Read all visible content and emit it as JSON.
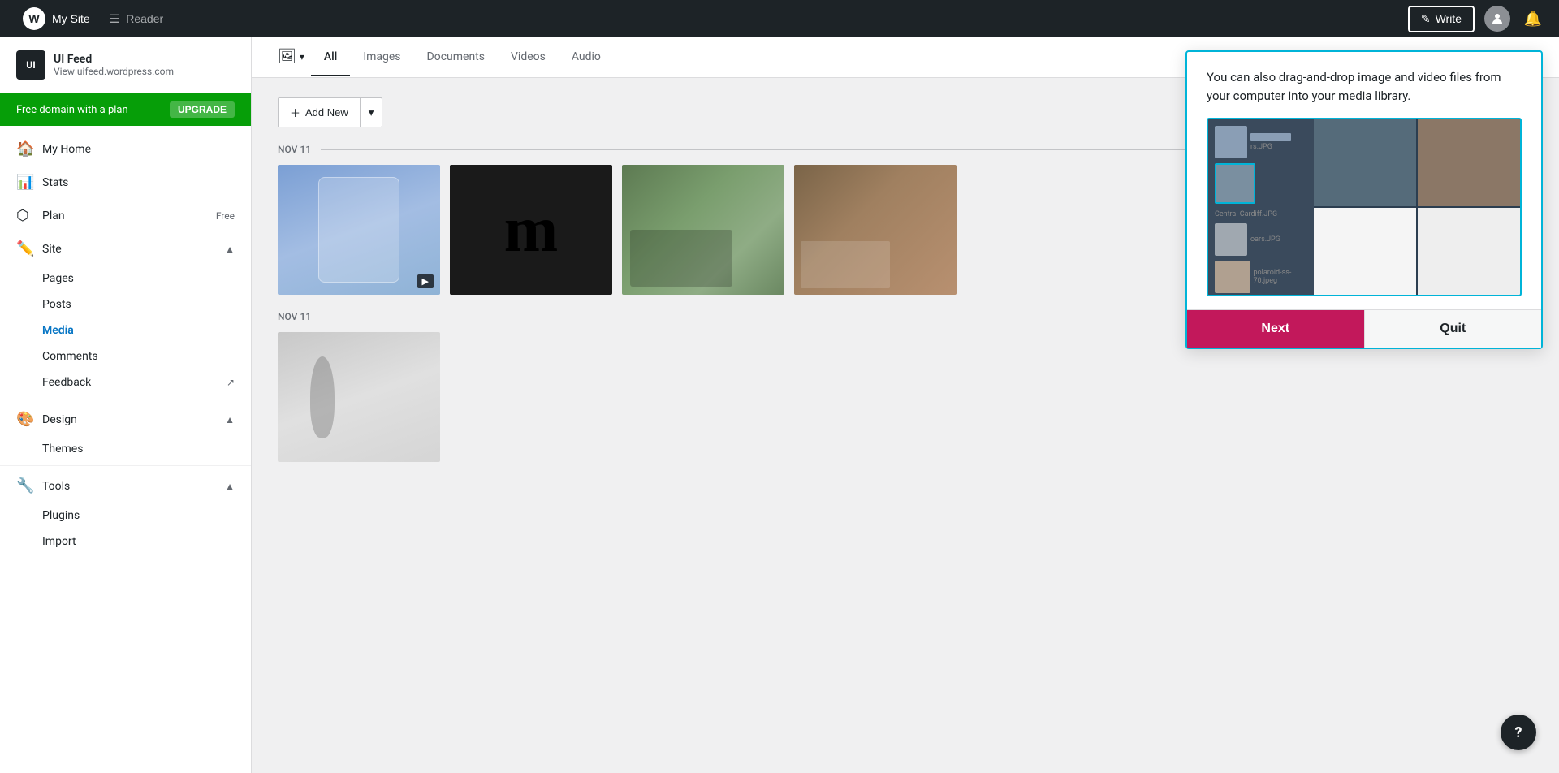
{
  "topbar": {
    "site_label": "My Site",
    "reader_label": "Reader",
    "write_label": "Write"
  },
  "sidebar": {
    "site_name": "UI Feed",
    "site_url": "View uifeed.wordpress.com",
    "site_icon_text": "UI",
    "upgrade_text": "Free domain with a plan",
    "upgrade_btn": "UPGRADE",
    "nav_items": [
      {
        "id": "my-home",
        "label": "My Home",
        "icon": "🏠",
        "badge": ""
      },
      {
        "id": "stats",
        "label": "Stats",
        "icon": "📊",
        "badge": ""
      },
      {
        "id": "plan",
        "label": "Plan",
        "icon": "⬡",
        "badge": "Free"
      },
      {
        "id": "site",
        "label": "Site",
        "icon": "✏️",
        "badge": "",
        "expanded": true
      }
    ],
    "site_subnav": [
      {
        "id": "pages",
        "label": "Pages"
      },
      {
        "id": "posts",
        "label": "Posts"
      },
      {
        "id": "media",
        "label": "Media",
        "active": true
      },
      {
        "id": "comments",
        "label": "Comments"
      },
      {
        "id": "feedback",
        "label": "Feedback",
        "external": true
      }
    ],
    "design_items": [
      {
        "id": "design",
        "label": "Design",
        "icon": "🎨",
        "expanded": true
      }
    ],
    "design_subnav": [
      {
        "id": "themes",
        "label": "Themes"
      }
    ],
    "tools_items": [
      {
        "id": "tools",
        "label": "Tools",
        "icon": "🔧",
        "expanded": true
      }
    ],
    "tools_subnav": [
      {
        "id": "plugins",
        "label": "Plugins"
      },
      {
        "id": "import",
        "label": "Import"
      }
    ]
  },
  "media": {
    "filter_icon": "🖼",
    "tabs": [
      {
        "id": "all",
        "label": "All",
        "active": true
      },
      {
        "id": "images",
        "label": "Images"
      },
      {
        "id": "documents",
        "label": "Documents"
      },
      {
        "id": "videos",
        "label": "Videos"
      },
      {
        "id": "audio",
        "label": "Audio"
      }
    ],
    "add_new_label": "Add New",
    "date_sections": [
      {
        "date": "NOV 11",
        "items": [
          {
            "id": "item1",
            "type": "app",
            "has_video": true
          },
          {
            "id": "item2",
            "type": "dark"
          },
          {
            "id": "item3",
            "type": "work"
          },
          {
            "id": "item4",
            "type": "news"
          }
        ]
      },
      {
        "date": "NOV 11",
        "items": [
          {
            "id": "item5",
            "type": "person"
          }
        ]
      }
    ]
  },
  "popover": {
    "text": "You can also drag-and-drop image and video files from your computer into your media library.",
    "next_label": "Next",
    "quit_label": "Quit",
    "img_labels": [
      "rs.JPG",
      "Central Cardiff.JPG",
      "oars.JPG",
      "polaroid-ss-70.jpeg"
    ]
  },
  "help": {
    "icon": "?"
  }
}
